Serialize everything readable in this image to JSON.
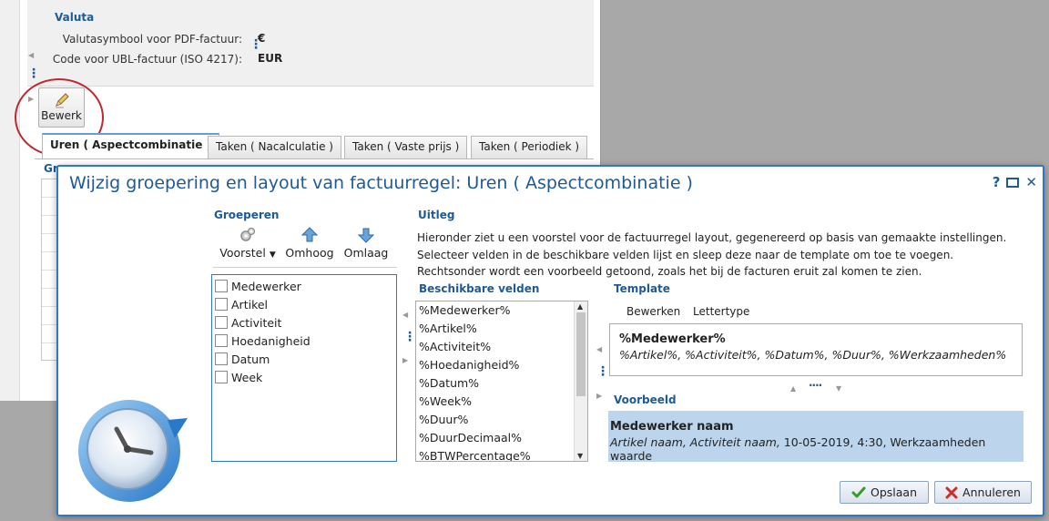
{
  "background_window": {
    "section_title": "Valuta",
    "currency_symbol_label": "Valutasymbool voor PDF-factuur:",
    "currency_symbol_value": "€",
    "ubl_code_label": "Code voor UBL-factuur (ISO 4217):",
    "ubl_code_value": "EUR",
    "edit_button_label": "Bewerk",
    "tabs": [
      {
        "label": "Uren ( Aspectcombinatie )",
        "active": true
      },
      {
        "label": "Taken ( Nacalculatie )",
        "active": false
      },
      {
        "label": "Taken ( Vaste prijs )",
        "active": false
      },
      {
        "label": "Taken ( Periodiek )",
        "active": false
      }
    ],
    "group_label_fragment": "Gr"
  },
  "dialog": {
    "title": "Wijzig groepering en layout van factuurregel: Uren ( Aspectcombinatie )",
    "controls": {
      "help": "?",
      "close": "✕"
    },
    "grouping": {
      "heading": "Groeperen",
      "toolbar": {
        "suggest_label": "Voorstel",
        "up_label": "Omhoog",
        "down_label": "Omlaag"
      },
      "items": [
        {
          "label": "Medewerker",
          "checked": false
        },
        {
          "label": "Artikel",
          "checked": false
        },
        {
          "label": "Activiteit",
          "checked": false
        },
        {
          "label": "Hoedanigheid",
          "checked": false
        },
        {
          "label": "Datum",
          "checked": false
        },
        {
          "label": "Week",
          "checked": false
        }
      ]
    },
    "explanation": {
      "heading": "Uitleg",
      "lines": [
        "Hieronder ziet u een voorstel voor de factuurregel layout, gegenereerd op basis van gemaakte instellingen.",
        "Selecteer velden in de beschikbare velden lijst en sleep deze naar de template om toe te voegen.",
        "Rechtsonder wordt een voorbeeld getoond, zoals het bij de facturen eruit zal komen te zien."
      ]
    },
    "available_fields": {
      "heading": "Beschikbare velden",
      "items": [
        "%Medewerker%",
        "%Artikel%",
        "%Activiteit%",
        "%Hoedanigheid%",
        "%Datum%",
        "%Week%",
        "%Duur%",
        "%DuurDecimaal%",
        "%BTWPercentage%"
      ]
    },
    "template": {
      "heading": "Template",
      "tab_edit": "Bewerken",
      "tab_font": "Lettertype",
      "line1": "%Medewerker%",
      "line2": "%Artikel%, %Activiteit%, %Datum%, %Duur%, %Werkzaamheden%"
    },
    "preview": {
      "heading": "Voorbeeld",
      "line1": "Medewerker naam",
      "line2_italic": "Artikel naam, Activiteit naam,",
      "line2_rest": " 10-05-2019, 4:30, Werkzaamheden waarde"
    },
    "buttons": {
      "save": "Opslaan",
      "cancel": "Annuleren"
    },
    "colors": {
      "accent": "#2e78c6",
      "heading": "#1f5a96",
      "preview_bg": "#bdd5ec",
      "highlight_circle": "#c0282d"
    }
  }
}
